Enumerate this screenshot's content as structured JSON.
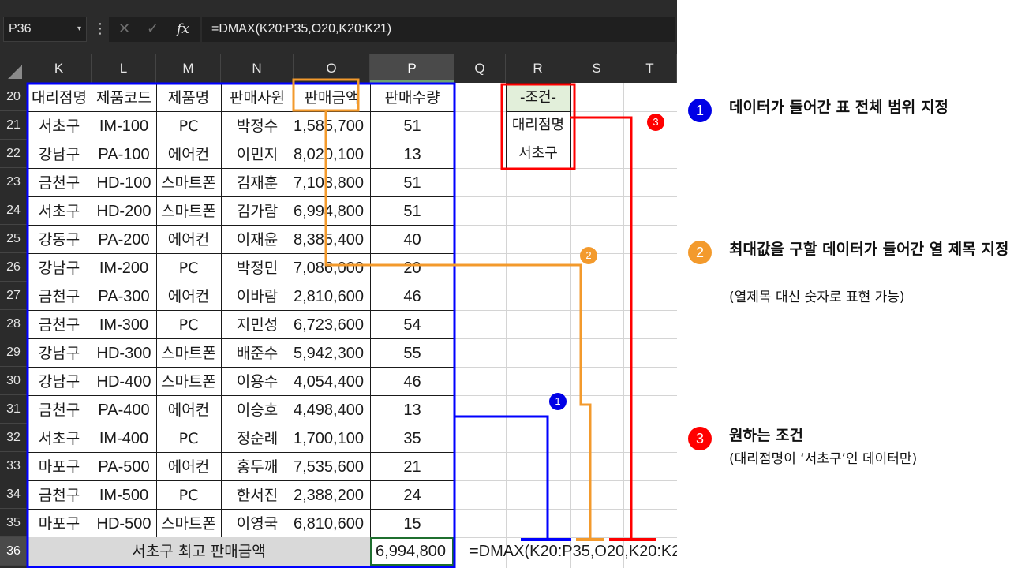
{
  "formula_bar": {
    "name_box": "P36",
    "name_box_arrow": "▾",
    "dots": "⋮",
    "cancel": "✕",
    "enter": "✓",
    "fx": "fx",
    "formula": "=DMAX(K20:P35,O20,K20:K21)"
  },
  "columns": [
    "K",
    "L",
    "M",
    "N",
    "O",
    "P",
    "Q",
    "R",
    "S",
    "T"
  ],
  "selected_column": "P",
  "rows": [
    "20",
    "21",
    "22",
    "23",
    "24",
    "25",
    "26",
    "27",
    "28",
    "29",
    "30",
    "31",
    "32",
    "33",
    "34",
    "35",
    "36"
  ],
  "selected_row": "36",
  "table": {
    "headers": [
      "대리점명",
      "제품코드",
      "제품명",
      "판매사원",
      "판매금액",
      "판매수량"
    ],
    "data": [
      [
        "서초구",
        "IM-100",
        "PC",
        "박정수",
        "1,585,700",
        "51"
      ],
      [
        "강남구",
        "PA-100",
        "에어컨",
        "이민지",
        "8,020,100",
        "13"
      ],
      [
        "금천구",
        "HD-100",
        "스마트폰",
        "김재훈",
        "7,103,800",
        "51"
      ],
      [
        "서초구",
        "HD-200",
        "스마트폰",
        "김가람",
        "6,994,800",
        "51"
      ],
      [
        "강동구",
        "PA-200",
        "에어컨",
        "이재윤",
        "8,385,400",
        "40"
      ],
      [
        "강남구",
        "IM-200",
        "PC",
        "박정민",
        "7,086,000",
        "20"
      ],
      [
        "금천구",
        "PA-300",
        "에어컨",
        "이바람",
        "2,810,600",
        "46"
      ],
      [
        "금천구",
        "IM-300",
        "PC",
        "지민성",
        "6,723,600",
        "54"
      ],
      [
        "강남구",
        "HD-300",
        "스마트폰",
        "배준수",
        "5,942,300",
        "55"
      ],
      [
        "강남구",
        "HD-400",
        "스마트폰",
        "이용수",
        "4,054,400",
        "46"
      ],
      [
        "금천구",
        "PA-400",
        "에어컨",
        "이승호",
        "4,498,400",
        "13"
      ],
      [
        "서초구",
        "IM-400",
        "PC",
        "정순례",
        "1,700,100",
        "35"
      ],
      [
        "마포구",
        "PA-500",
        "에어컨",
        "홍두깨",
        "7,535,600",
        "21"
      ],
      [
        "금천구",
        "IM-500",
        "PC",
        "한서진",
        "2,388,200",
        "24"
      ],
      [
        "마포구",
        "HD-500",
        "스마트폰",
        "이영국",
        "6,810,600",
        "15"
      ]
    ],
    "summary_label": "서초구 최고 판매금액",
    "result": "6,994,800",
    "formula_display": "=DMAX(K20:P35,O20,K20:K21)"
  },
  "criteria": {
    "header": "-조건-",
    "field": "대리점명",
    "value": "서초구"
  },
  "colors": {
    "blue": "#0000ff",
    "orange": "#f39a2c",
    "red": "#ff0000",
    "criteria_fill": "#e2efda",
    "summary_fill": "#d9d9d9",
    "dark_ui": "#2b2b2b"
  },
  "annotations": [
    {
      "number": "1",
      "color": "#0000e6",
      "title": "데이터가 들어간 표 전체 범위 지정",
      "sub": ""
    },
    {
      "number": "2",
      "color": "#f39a2c",
      "title": "최대값을 구할 데이터가 들어간 열 제목 지정",
      "sub": "(열제목 대신 숫자로 표현 가능)"
    },
    {
      "number": "3",
      "color": "#ff0000",
      "title": "원하는 조건",
      "sub": "(대리점명이 ‘서초구’인 데이터만)"
    }
  ]
}
